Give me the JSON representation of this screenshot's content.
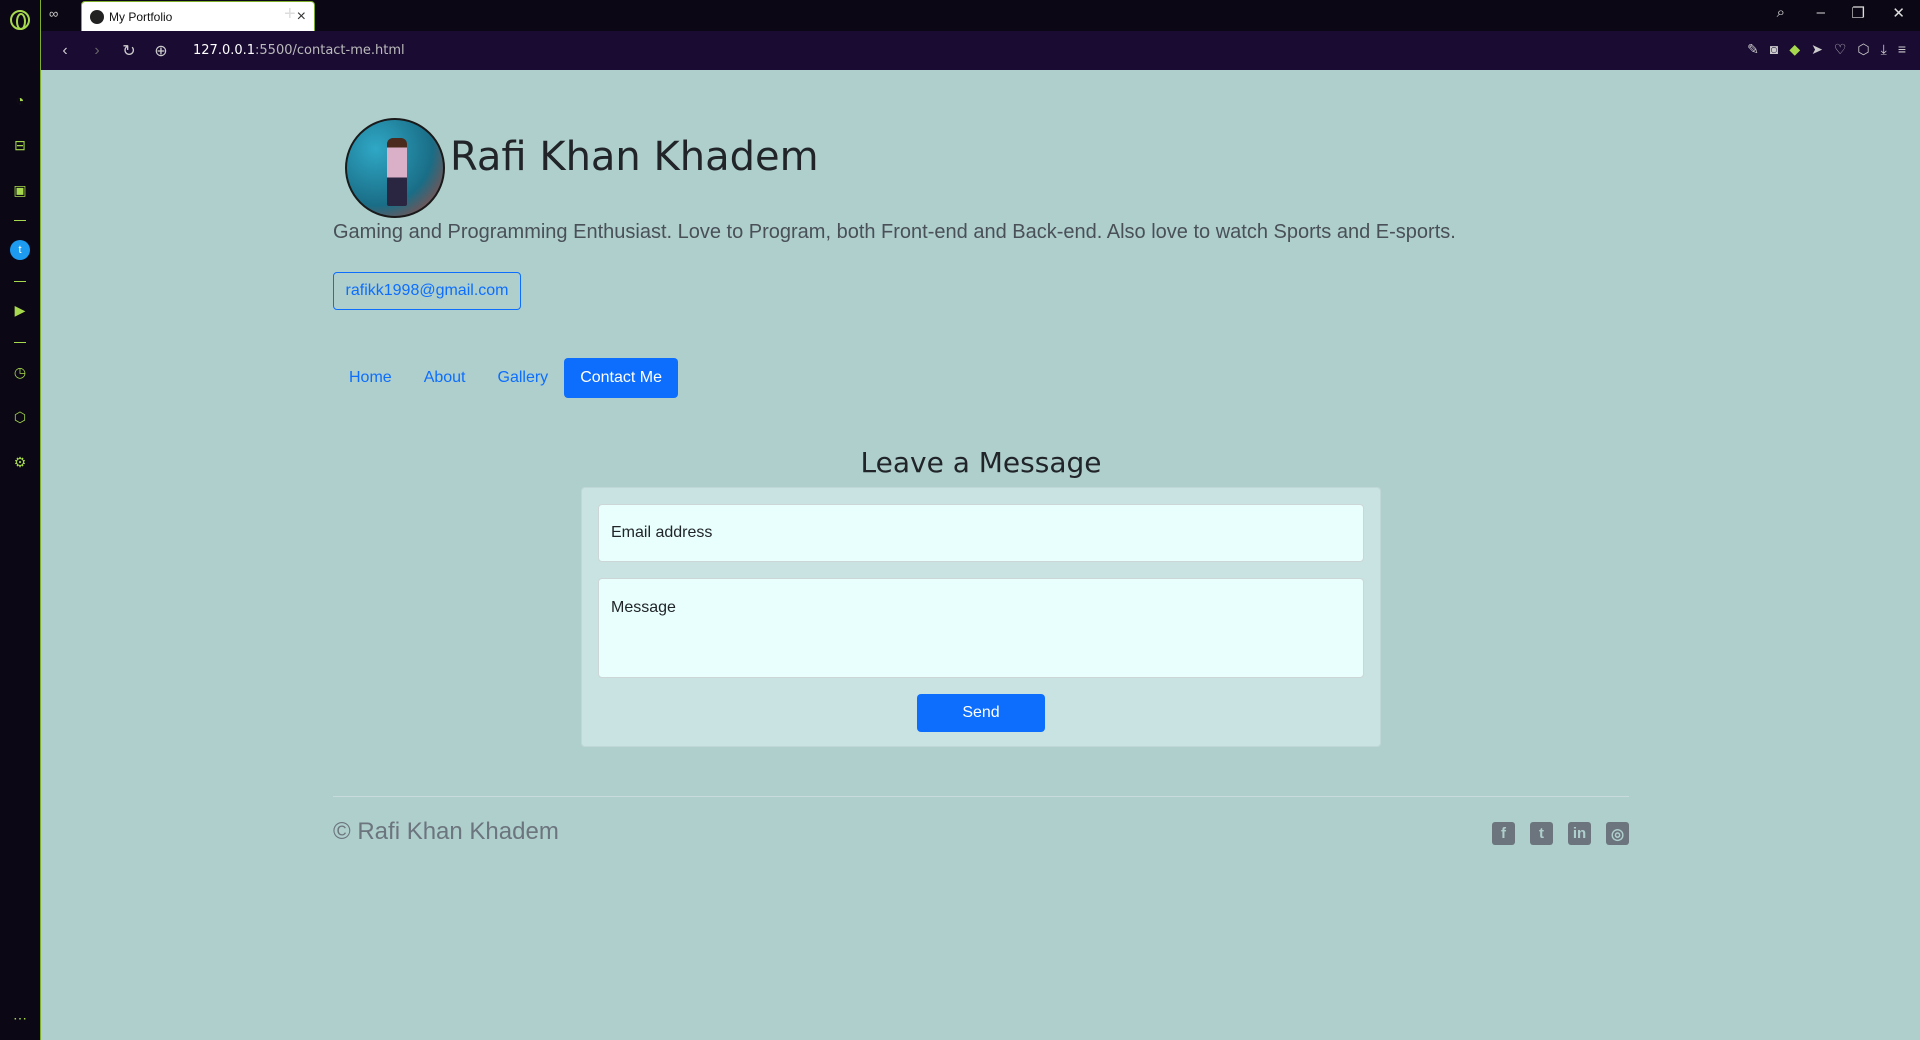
{
  "browser": {
    "tab_title": "My Portfolio",
    "url_host": "127.0.0.1",
    "url_rest": ":5500/contact-me.html"
  },
  "profile": {
    "name": "Rafi Khan Khadem",
    "tagline": "Gaming and Programming Enthusiast. Love to Program, both Front-end and Back-end. Also love to watch Sports and E-sports.",
    "email": "rafikk1998@gmail.com"
  },
  "nav": {
    "items": [
      {
        "label": "Home"
      },
      {
        "label": "About"
      },
      {
        "label": "Gallery"
      },
      {
        "label": "Contact Me"
      }
    ],
    "active": "Contact Me"
  },
  "form": {
    "title": "Leave a Message",
    "email_placeholder": "Email address",
    "message_placeholder": "Message",
    "send_label": "Send"
  },
  "footer": {
    "copyright": "© Rafi Khan Khadem",
    "social": [
      "facebook-icon",
      "twitter-icon",
      "linkedin-icon",
      "steam-icon"
    ]
  },
  "colors": {
    "page_bg": "#afcfcd",
    "primary": "#0d6efd",
    "browser_accent": "#a7d94f"
  }
}
